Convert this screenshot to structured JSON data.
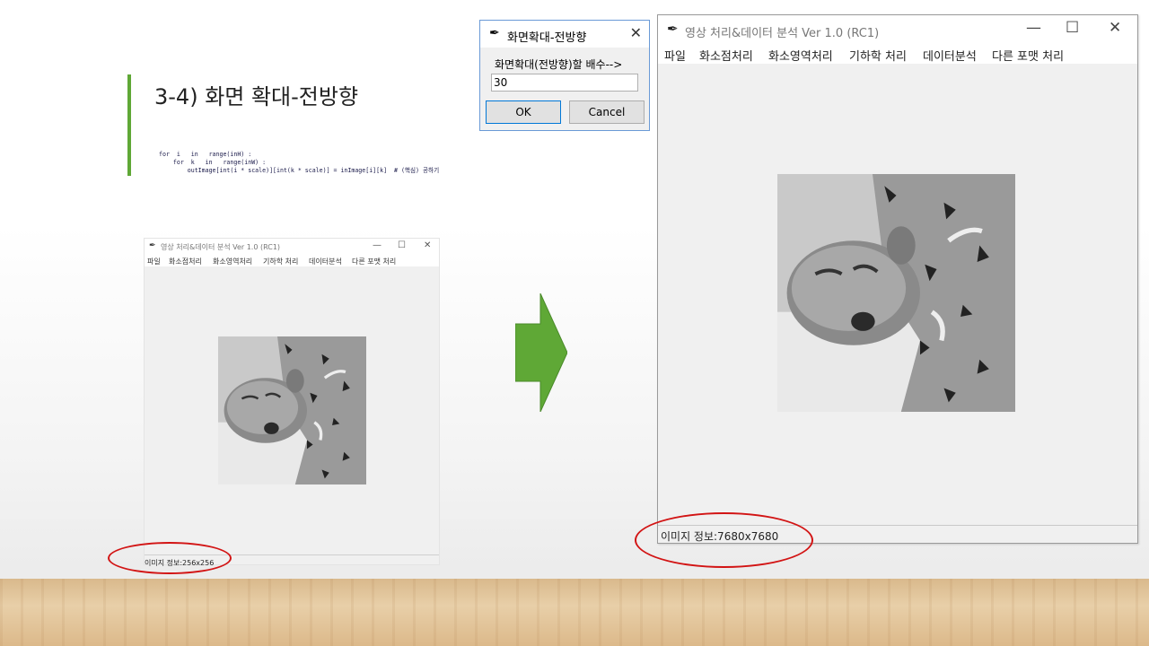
{
  "slide": {
    "title": "3-4) 화면 확대-전방향",
    "code_lines": [
      "for  i   in   range(inH) :",
      "    for  k   in   range(inW) :",
      "        outImage[int(i * scale)][int(k * scale)] = inImage[i][k]  # (핵심) 공하기"
    ]
  },
  "small_window": {
    "title": "영상 처리&데이터 분석 Ver 1.0 (RC1)",
    "menu": [
      "파일",
      "화소점처리",
      "화소영역처리",
      "기하학 처리",
      "데이터분석",
      "다른 포맷 처리"
    ],
    "status": "이미지 정보:256x256"
  },
  "dialog": {
    "title": "화면확대-전방향",
    "prompt": "화면확대(전방향)할 배수-->",
    "input_value": "30",
    "ok_label": "OK",
    "cancel_label": "Cancel"
  },
  "large_window": {
    "title": "영상 처리&데이터 분석 Ver 1.0 (RC1)",
    "menu": [
      "파일",
      "화소점처리",
      "화소영역처리",
      "기하학 처리",
      "데이터분석",
      "다른 포맷 처리"
    ],
    "status": "이미지 정보:7680x7680"
  },
  "window_controls": {
    "minimize": "—",
    "maximize": "☐",
    "close": "✕"
  },
  "colors": {
    "accent_green": "#5fa836",
    "highlight_red": "#d21414",
    "dialog_border": "#6a9ad6"
  }
}
